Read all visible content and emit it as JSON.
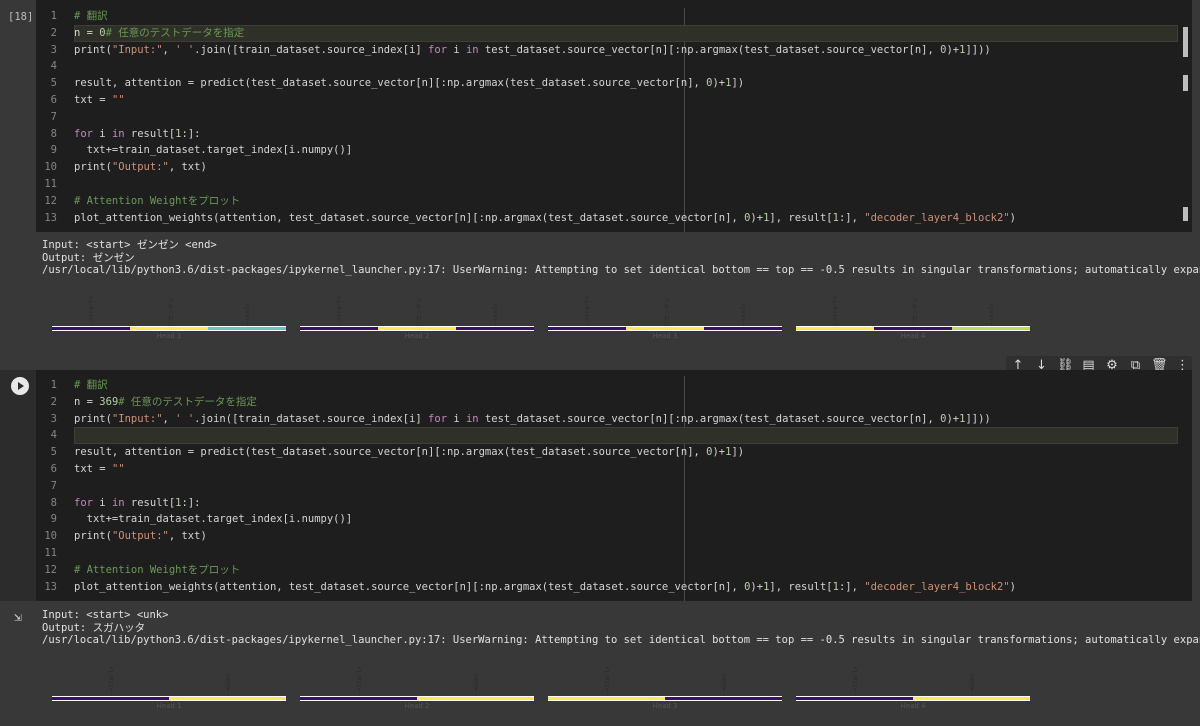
{
  "cell1": {
    "exec_count": "[18]",
    "lines": [
      {
        "n": "1",
        "t": "# 翻訳"
      },
      {
        "n": "2",
        "t": "n = 0# 任意のテストデータを指定"
      },
      {
        "n": "3",
        "t": "print(\"Input:\", ' '.join([train_dataset.source_index[i] for i in test_dataset.source_vector[n][:np.argmax(test_dataset.source_vector[n], 0)+1]]))"
      },
      {
        "n": "4",
        "t": ""
      },
      {
        "n": "5",
        "t": "result, attention = predict(test_dataset.source_vector[n][:np.argmax(test_dataset.source_vector[n], 0)+1])"
      },
      {
        "n": "6",
        "t": "txt = \"\""
      },
      {
        "n": "7",
        "t": ""
      },
      {
        "n": "8",
        "t": "for i in result[1:]:"
      },
      {
        "n": "9",
        "t": "  txt+=train_dataset.target_index[i.numpy()]"
      },
      {
        "n": "10",
        "t": "print(\"Output:\", txt)"
      },
      {
        "n": "11",
        "t": ""
      },
      {
        "n": "12",
        "t": "# Attention Weightをプロット"
      },
      {
        "n": "13",
        "t": "plot_attention_weights(attention, test_dataset.source_vector[n][:np.argmax(test_dataset.source_vector[n], 0)+1], result[1:], \"decoder_layer4_block2\")"
      }
    ],
    "output": [
      "Input: <start> ゼンゼン <end>",
      "Output: ゼンゼン",
      "/usr/local/lib/python3.6/dist-packages/ipykernel_launcher.py:17: UserWarning: Attempting to set identical bottom == top == -0.5 results in singular transformations; automatically expanding."
    ],
    "heads": [
      {
        "label": "Head 1",
        "ticks": [
          "<start>",
          "ゼンゼン",
          "<end>"
        ],
        "colors": [
          "#3b0f70",
          "#f9e94f",
          "#5ec9c0"
        ]
      },
      {
        "label": "Head 2",
        "ticks": [
          "<start>",
          "ゼンゼン",
          "<end>"
        ],
        "colors": [
          "#3b0f70",
          "#f9e94f",
          "#3b0f70"
        ]
      },
      {
        "label": "Head 3",
        "ticks": [
          "<start>",
          "ゼンゼン",
          "<end>"
        ],
        "colors": [
          "#3b0f70",
          "#f9e94f",
          "#3b0f70"
        ]
      },
      {
        "label": "Head 4",
        "ticks": [
          "<start>",
          "ゼンゼン",
          "<end>"
        ],
        "colors": [
          "#f9e94f",
          "#3b0f70",
          "#b8de5a"
        ]
      }
    ]
  },
  "cell2": {
    "lines": [
      {
        "n": "1",
        "t": "# 翻訳"
      },
      {
        "n": "2",
        "t": "n = 369# 任意のテストデータを指定"
      },
      {
        "n": "3",
        "t": "print(\"Input:\", ' '.join([train_dataset.source_index[i] for i in test_dataset.source_vector[n][:np.argmax(test_dataset.source_vector[n], 0)+1]]))"
      },
      {
        "n": "4",
        "t": ""
      },
      {
        "n": "5",
        "t": "result, attention = predict(test_dataset.source_vector[n][:np.argmax(test_dataset.source_vector[n], 0)+1])"
      },
      {
        "n": "6",
        "t": "txt = \"\""
      },
      {
        "n": "7",
        "t": ""
      },
      {
        "n": "8",
        "t": "for i in result[1:]:"
      },
      {
        "n": "9",
        "t": "  txt+=train_dataset.target_index[i.numpy()]"
      },
      {
        "n": "10",
        "t": "print(\"Output:\", txt)"
      },
      {
        "n": "11",
        "t": ""
      },
      {
        "n": "12",
        "t": "# Attention Weightをプロット"
      },
      {
        "n": "13",
        "t": "plot_attention_weights(attention, test_dataset.source_vector[n][:np.argmax(test_dataset.source_vector[n], 0)+1], result[1:], \"decoder_layer4_block2\")"
      }
    ],
    "output": [
      "Input: <start> <unk>",
      "Output: スガハッタ",
      "/usr/local/lib/python3.6/dist-packages/ipykernel_launcher.py:17: UserWarning: Attempting to set identical bottom == top == -0.5 results in singular transformations; automatically expanding."
    ],
    "heads": [
      {
        "label": "Head 1",
        "ticks": [
          "<start>",
          "<unk>"
        ],
        "colors": [
          "#3b0f70",
          "#f9e94f"
        ]
      },
      {
        "label": "Head 2",
        "ticks": [
          "<start>",
          "<unk>"
        ],
        "colors": [
          "#3b0f70",
          "#f9e94f"
        ]
      },
      {
        "label": "Head 3",
        "ticks": [
          "<start>",
          "<unk>"
        ],
        "colors": [
          "#f9e94f",
          "#3b0f70"
        ]
      },
      {
        "label": "Head 4",
        "ticks": [
          "<start>",
          "<unk>"
        ],
        "colors": [
          "#3b0f70",
          "#f9e94f"
        ]
      }
    ]
  },
  "toolbar": {
    "icons": [
      "arrow-up-icon",
      "arrow-down-icon",
      "link-icon",
      "comment-icon",
      "gear-icon",
      "mirror-icon",
      "trash-icon",
      "more-icon"
    ],
    "glyphs": [
      "↑",
      "↓",
      "⛓",
      "▤",
      "⚙",
      "⧉",
      "🗑",
      "⋮"
    ]
  }
}
